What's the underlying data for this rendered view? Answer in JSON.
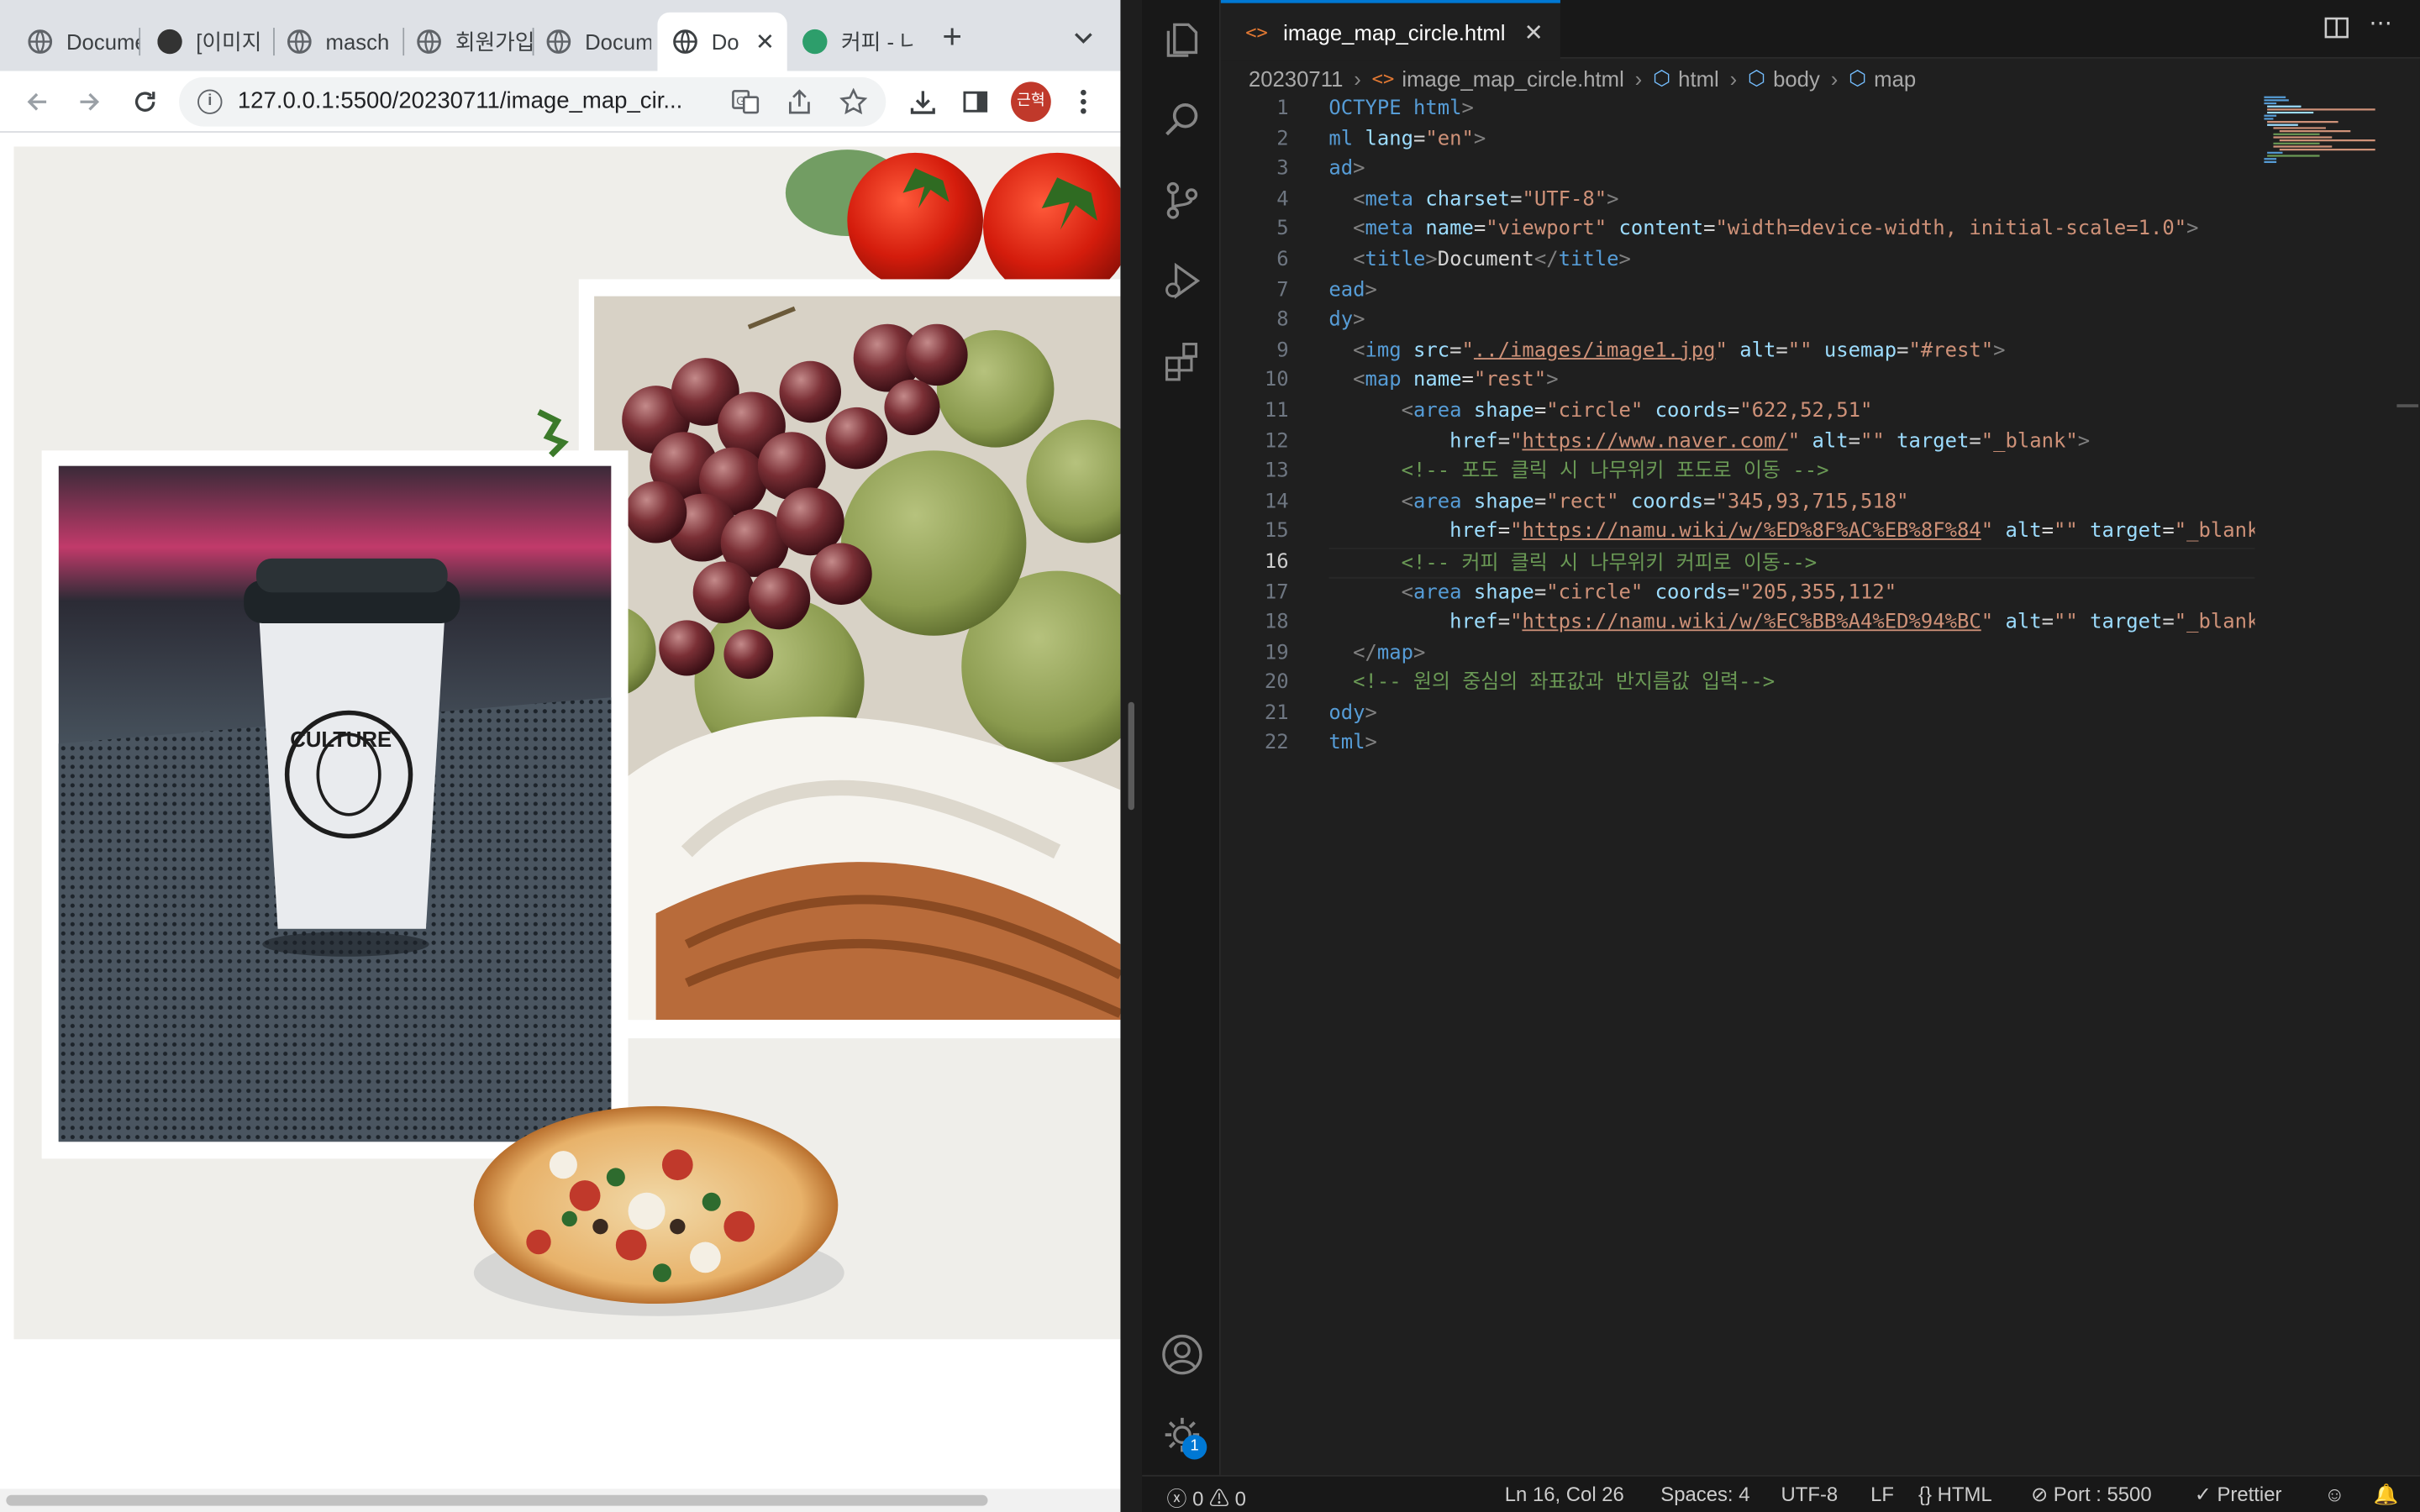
{
  "browser": {
    "tabs": [
      {
        "title": "Document"
      },
      {
        "title": "[이미지"
      },
      {
        "title": "masch"
      },
      {
        "title": "회원가입"
      },
      {
        "title": "Document"
      },
      {
        "title": "Do"
      },
      {
        "title": "커피 - 나"
      }
    ],
    "active_tab_index": 5,
    "new_tab": "+",
    "url": "127.0.0.1:5500/20230711/image_map_cir...",
    "avatar_label": "근혁"
  },
  "page": {
    "image_alt": "",
    "regions": [
      "grape-area",
      "coffee-area"
    ]
  },
  "vscode": {
    "tab": {
      "title": "image_map_circle.html",
      "icon": "<>"
    },
    "breadcrumbs": {
      "folder": "20230711",
      "file": "image_map_circle.html",
      "n1": "html",
      "n2": "body",
      "n3": "map"
    },
    "current_line": 16,
    "code": [
      [
        {
          "t": "OCTYPE ",
          "c": "#569cd6"
        },
        {
          "t": "html",
          "c": "#569cd6"
        },
        {
          "t": ">",
          "c": "#808080"
        }
      ],
      [
        {
          "t": "ml ",
          "c": "#569cd6"
        },
        {
          "t": "lang",
          "c": "#9cdcfe"
        },
        {
          "t": "=",
          "c": "#d4d4d4"
        },
        {
          "t": "\"en\"",
          "c": "#ce9178"
        },
        {
          "t": ">",
          "c": "#808080"
        }
      ],
      [
        {
          "t": "ad",
          "c": "#569cd6"
        },
        {
          "t": ">",
          "c": "#808080"
        }
      ],
      [
        {
          "t": "  <",
          "c": "#808080"
        },
        {
          "t": "meta ",
          "c": "#569cd6"
        },
        {
          "t": "charset",
          "c": "#9cdcfe"
        },
        {
          "t": "=",
          "c": "#d4d4d4"
        },
        {
          "t": "\"UTF-8\"",
          "c": "#ce9178"
        },
        {
          "t": ">",
          "c": "#808080"
        }
      ],
      [
        {
          "t": "  <",
          "c": "#808080"
        },
        {
          "t": "meta ",
          "c": "#569cd6"
        },
        {
          "t": "name",
          "c": "#9cdcfe"
        },
        {
          "t": "=",
          "c": "#d4d4d4"
        },
        {
          "t": "\"viewport\" ",
          "c": "#ce9178"
        },
        {
          "t": "content",
          "c": "#9cdcfe"
        },
        {
          "t": "=",
          "c": "#d4d4d4"
        },
        {
          "t": "\"width=device-width, initial-scale=1.0\"",
          "c": "#ce9178"
        },
        {
          "t": ">",
          "c": "#808080"
        }
      ],
      [
        {
          "t": "  <",
          "c": "#808080"
        },
        {
          "t": "title",
          "c": "#569cd6"
        },
        {
          "t": ">",
          "c": "#808080"
        },
        {
          "t": "Document",
          "c": "#d4d4d4"
        },
        {
          "t": "</",
          "c": "#808080"
        },
        {
          "t": "title",
          "c": "#569cd6"
        },
        {
          "t": ">",
          "c": "#808080"
        }
      ],
      [
        {
          "t": "ead",
          "c": "#569cd6"
        },
        {
          "t": ">",
          "c": "#808080"
        }
      ],
      [
        {
          "t": "dy",
          "c": "#569cd6"
        },
        {
          "t": ">",
          "c": "#808080"
        }
      ],
      [
        {
          "t": "  <",
          "c": "#808080"
        },
        {
          "t": "img ",
          "c": "#569cd6"
        },
        {
          "t": "src",
          "c": "#9cdcfe"
        },
        {
          "t": "=",
          "c": "#d4d4d4"
        },
        {
          "t": "\"",
          "c": "#ce9178"
        },
        {
          "t": "../images/image1.jpg",
          "c": "#ce9178",
          "u": true
        },
        {
          "t": "\" ",
          "c": "#ce9178"
        },
        {
          "t": "alt",
          "c": "#9cdcfe"
        },
        {
          "t": "=",
          "c": "#d4d4d4"
        },
        {
          "t": "\"\" ",
          "c": "#ce9178"
        },
        {
          "t": "usemap",
          "c": "#9cdcfe"
        },
        {
          "t": "=",
          "c": "#d4d4d4"
        },
        {
          "t": "\"#rest\"",
          "c": "#ce9178"
        },
        {
          "t": ">",
          "c": "#808080"
        }
      ],
      [
        {
          "t": "  <",
          "c": "#808080"
        },
        {
          "t": "map ",
          "c": "#569cd6"
        },
        {
          "t": "name",
          "c": "#9cdcfe"
        },
        {
          "t": "=",
          "c": "#d4d4d4"
        },
        {
          "t": "\"rest\"",
          "c": "#ce9178"
        },
        {
          "t": ">",
          "c": "#808080"
        }
      ],
      [
        {
          "t": "      <",
          "c": "#808080"
        },
        {
          "t": "area ",
          "c": "#569cd6"
        },
        {
          "t": "shape",
          "c": "#9cdcfe"
        },
        {
          "t": "=",
          "c": "#d4d4d4"
        },
        {
          "t": "\"circle\" ",
          "c": "#ce9178"
        },
        {
          "t": "coords",
          "c": "#9cdcfe"
        },
        {
          "t": "=",
          "c": "#d4d4d4"
        },
        {
          "t": "\"622,52,51\"",
          "c": "#ce9178"
        }
      ],
      [
        {
          "t": "          ",
          "c": "#d4d4d4"
        },
        {
          "t": "href",
          "c": "#9cdcfe"
        },
        {
          "t": "=",
          "c": "#d4d4d4"
        },
        {
          "t": "\"",
          "c": "#ce9178"
        },
        {
          "t": "https://www.naver.com/",
          "c": "#ce9178",
          "u": true
        },
        {
          "t": "\" ",
          "c": "#ce9178"
        },
        {
          "t": "alt",
          "c": "#9cdcfe"
        },
        {
          "t": "=",
          "c": "#d4d4d4"
        },
        {
          "t": "\"\" ",
          "c": "#ce9178"
        },
        {
          "t": "target",
          "c": "#9cdcfe"
        },
        {
          "t": "=",
          "c": "#d4d4d4"
        },
        {
          "t": "\"_blank\"",
          "c": "#ce9178"
        },
        {
          "t": ">",
          "c": "#808080"
        }
      ],
      [
        {
          "t": "      <!-- 포도 클릭 시 나무위키 포도로 이동 -->",
          "c": "#6a9955"
        }
      ],
      [
        {
          "t": "      <",
          "c": "#808080"
        },
        {
          "t": "area ",
          "c": "#569cd6"
        },
        {
          "t": "shape",
          "c": "#9cdcfe"
        },
        {
          "t": "=",
          "c": "#d4d4d4"
        },
        {
          "t": "\"rect\" ",
          "c": "#ce9178"
        },
        {
          "t": "coords",
          "c": "#9cdcfe"
        },
        {
          "t": "=",
          "c": "#d4d4d4"
        },
        {
          "t": "\"345,93,715,518\"",
          "c": "#ce9178"
        }
      ],
      [
        {
          "t": "          ",
          "c": "#d4d4d4"
        },
        {
          "t": "href",
          "c": "#9cdcfe"
        },
        {
          "t": "=",
          "c": "#d4d4d4"
        },
        {
          "t": "\"",
          "c": "#ce9178"
        },
        {
          "t": "https://namu.wiki/w/%ED%8F%AC%EB%8F%84",
          "c": "#ce9178",
          "u": true
        },
        {
          "t": "\" ",
          "c": "#ce9178"
        },
        {
          "t": "alt",
          "c": "#9cdcfe"
        },
        {
          "t": "=",
          "c": "#d4d4d4"
        },
        {
          "t": "\"\" ",
          "c": "#ce9178"
        },
        {
          "t": "target",
          "c": "#9cdcfe"
        },
        {
          "t": "=",
          "c": "#d4d4d4"
        },
        {
          "t": "\"_blank",
          "c": "#ce9178"
        }
      ],
      [
        {
          "t": "      <!-- 커피 클릭 시 나무위키 커피로 이동-->",
          "c": "#6a9955"
        }
      ],
      [
        {
          "t": "      <",
          "c": "#808080"
        },
        {
          "t": "area ",
          "c": "#569cd6"
        },
        {
          "t": "shape",
          "c": "#9cdcfe"
        },
        {
          "t": "=",
          "c": "#d4d4d4"
        },
        {
          "t": "\"circle\" ",
          "c": "#ce9178"
        },
        {
          "t": "coords",
          "c": "#9cdcfe"
        },
        {
          "t": "=",
          "c": "#d4d4d4"
        },
        {
          "t": "\"205,355,112\"",
          "c": "#ce9178"
        }
      ],
      [
        {
          "t": "          ",
          "c": "#d4d4d4"
        },
        {
          "t": "href",
          "c": "#9cdcfe"
        },
        {
          "t": "=",
          "c": "#d4d4d4"
        },
        {
          "t": "\"",
          "c": "#ce9178"
        },
        {
          "t": "https://namu.wiki/w/%EC%BB%A4%ED%94%BC",
          "c": "#ce9178",
          "u": true
        },
        {
          "t": "\" ",
          "c": "#ce9178"
        },
        {
          "t": "alt",
          "c": "#9cdcfe"
        },
        {
          "t": "=",
          "c": "#d4d4d4"
        },
        {
          "t": "\"\" ",
          "c": "#ce9178"
        },
        {
          "t": "target",
          "c": "#9cdcfe"
        },
        {
          "t": "=",
          "c": "#d4d4d4"
        },
        {
          "t": "\"_blank",
          "c": "#ce9178"
        }
      ],
      [
        {
          "t": "  </",
          "c": "#808080"
        },
        {
          "t": "map",
          "c": "#569cd6"
        },
        {
          "t": ">",
          "c": "#808080"
        }
      ],
      [
        {
          "t": "  <!-- 원의 중심의 좌표값과 반지름값 입력-->",
          "c": "#6a9955"
        }
      ],
      [
        {
          "t": "ody",
          "c": "#569cd6"
        },
        {
          "t": ">",
          "c": "#808080"
        }
      ],
      [
        {
          "t": "tml",
          "c": "#569cd6"
        },
        {
          "t": ">",
          "c": "#808080"
        }
      ]
    ],
    "status": {
      "errors": "0",
      "warnings": "0",
      "position": "Ln 16, Col 26",
      "spaces": "Spaces: 4",
      "encoding": "UTF-8",
      "eol": "LF",
      "language": "HTML",
      "port": "Port : 5500",
      "formatter": "Prettier"
    },
    "settings_badge": "1"
  }
}
